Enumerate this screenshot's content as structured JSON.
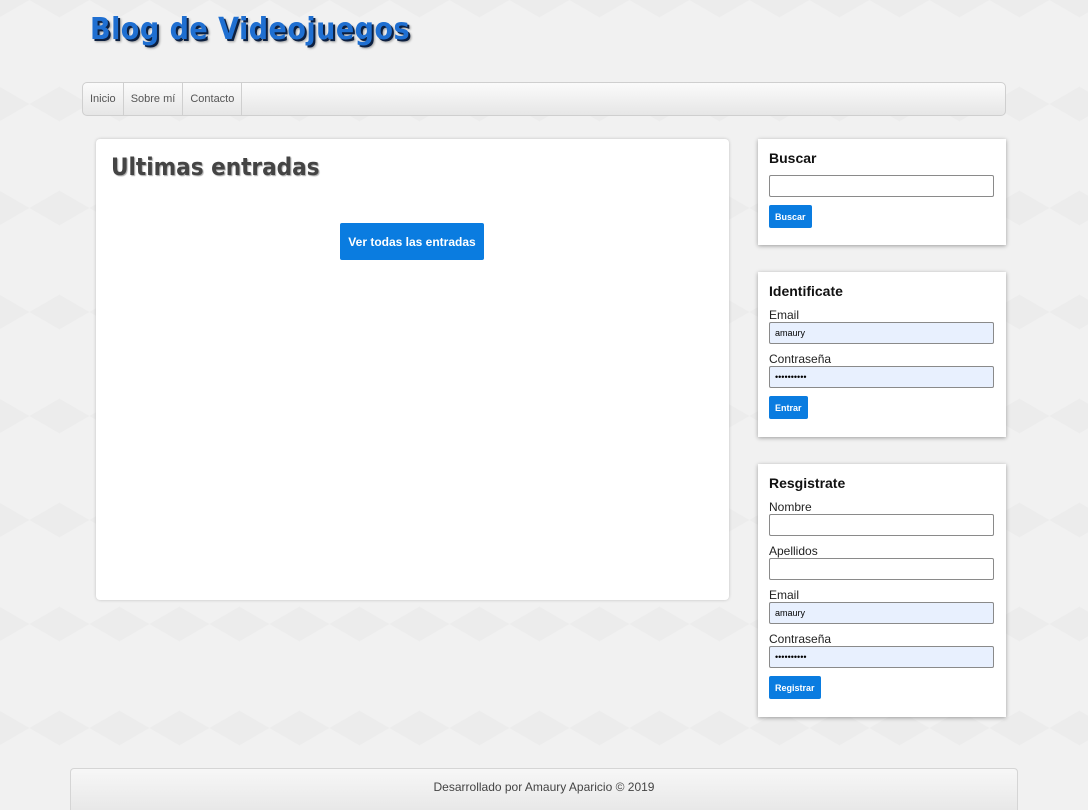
{
  "header": {
    "title": "Blog de Videojuegos"
  },
  "nav": {
    "items": [
      {
        "label": "Inicio"
      },
      {
        "label": "Sobre mí"
      },
      {
        "label": "Contacto"
      }
    ]
  },
  "main": {
    "title": "Ultimas entradas",
    "view_all_label": "Ver todas las entradas"
  },
  "search": {
    "title": "Buscar",
    "value": "",
    "button_label": "Buscar"
  },
  "login": {
    "title": "Identificate",
    "email_label": "Email",
    "email_value": "amaury",
    "password_label": "Contraseña",
    "password_value": "••••••••••",
    "button_label": "Entrar"
  },
  "register": {
    "title": "Resgistrate",
    "name_label": "Nombre",
    "name_value": "",
    "lastname_label": "Apellidos",
    "lastname_value": "",
    "email_label": "Email",
    "email_value": "amaury",
    "password_label": "Contraseña",
    "password_value": "••••••••••",
    "button_label": "Registrar"
  },
  "footer": {
    "text": "Desarrollado por Amaury Aparicio © 2019"
  },
  "colors": {
    "accent": "#0a7ce0",
    "title_blue": "#1f6fd1",
    "autofill": "#e8f0fe"
  }
}
